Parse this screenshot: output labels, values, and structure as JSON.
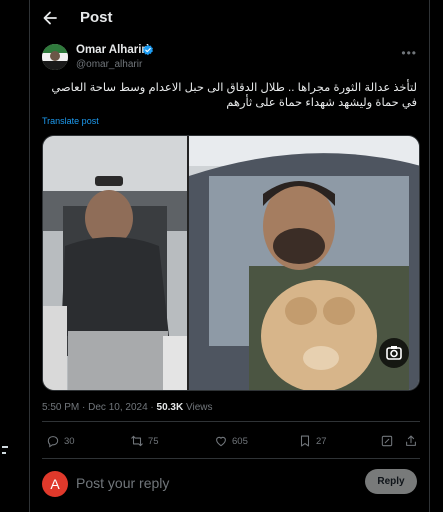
{
  "header": {
    "title": "Post"
  },
  "author": {
    "name": "Omar Alhariri",
    "handle": "@omar_alharir"
  },
  "tweet": {
    "text": "لتأخذ عدالة الثورة مجراها .. طلال الدقاق الى حبل الاعدام وسط ساحة العاصي في حماة وليشهد شهداء حماة على ثأرهم",
    "translate_label": "Translate post"
  },
  "meta": {
    "time": "5:50 PM",
    "separator": " · ",
    "date": "Dec 10, 2024",
    "views_count": "50.3K",
    "views_label": " Views"
  },
  "actions": {
    "replies": "30",
    "reposts": "75",
    "likes": "605",
    "bookmarks": "27"
  },
  "reply_box": {
    "avatar_letter": "A",
    "placeholder": "Post your reply",
    "button_label": "Reply"
  },
  "colors": {
    "accent": "#1d9bf0",
    "reply_avatar": "#e0392b",
    "reply_button": "#787a7a"
  },
  "icons": [
    "back-arrow-icon",
    "verified-badge-icon",
    "more-icon",
    "camera-icon",
    "reply-icon",
    "repost-icon",
    "like-icon",
    "bookmark-icon",
    "share-icon"
  ]
}
